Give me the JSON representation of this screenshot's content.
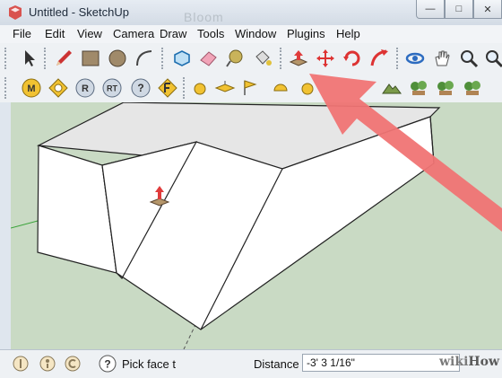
{
  "window": {
    "title": "Untitled - SketchUp",
    "ghost_title": "Bloom",
    "controls": {
      "minimize": "—",
      "maximize": "□",
      "close": "✕"
    }
  },
  "menu": {
    "items": [
      "File",
      "Edit",
      "View",
      "Camera",
      "Draw",
      "Tools",
      "Window",
      "Plugins",
      "Help"
    ]
  },
  "toolbar_row1": {
    "tools": [
      "select-tool",
      "line-tool",
      "rectangle-tool",
      "circle-tool",
      "arc-tool",
      "make-component-tool",
      "eraser-tool",
      "tape-measure-tool",
      "paint-bucket-tool",
      "push-pull-tool",
      "move-tool",
      "rotate-tool",
      "follow-me-tool",
      "orbit-tool",
      "pan-tool",
      "zoom-tool",
      "zoom-extents-tool"
    ]
  },
  "toolbar_row2": {
    "tools": [
      {
        "icon": "m-badge",
        "glyph": "M"
      },
      {
        "icon": "g-badge",
        "glyph": ""
      },
      {
        "icon": "r-badge",
        "glyph": "R"
      },
      {
        "icon": "rt-badge",
        "glyph": "RT"
      },
      {
        "icon": "help-badge",
        "glyph": "?"
      },
      {
        "icon": "f-badge",
        "glyph": ""
      },
      {
        "icon": "sphere-icon",
        "glyph": ""
      },
      {
        "icon": "plane-icon",
        "glyph": ""
      },
      {
        "icon": "flag-icon",
        "glyph": ""
      },
      {
        "icon": "hemisphere-icon",
        "glyph": ""
      },
      {
        "icon": "sphere2-icon",
        "glyph": ""
      },
      {
        "icon": "terrain-icon",
        "glyph": ""
      },
      {
        "icon": "tree-icon",
        "glyph": ""
      },
      {
        "icon": "tree2-icon",
        "glyph": ""
      }
    ]
  },
  "status": {
    "hint": "Pick face t",
    "distance_label": "Distance",
    "distance_value": "-3' 3 1/16\"",
    "icons": [
      "geo-location-icon",
      "credits-icon",
      "copyright-icon",
      "instructor-help-icon"
    ]
  },
  "watermark": {
    "wiki": "wiki",
    "how": "How"
  },
  "colors": {
    "viewport_bg": "#c9dac4",
    "highlight_arrow": "#f07474",
    "push_pull_red": "#e03b3b"
  }
}
